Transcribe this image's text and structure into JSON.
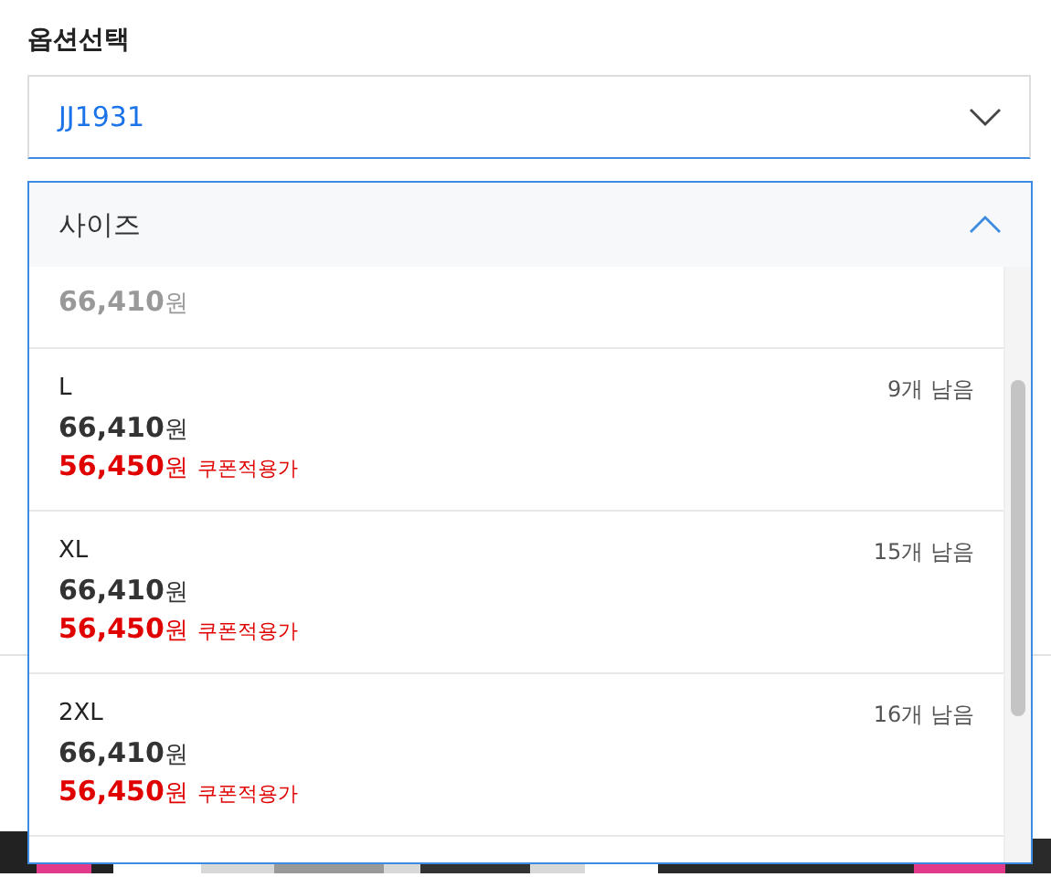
{
  "section_title": "옵션선택",
  "option_select": {
    "value": "JJ1931",
    "expanded": false
  },
  "size_dropdown": {
    "label": "사이즈",
    "expanded": true,
    "options": [
      {
        "kind": "partial",
        "sold_out": true,
        "price": "66,410",
        "unit": "원"
      },
      {
        "kind": "full",
        "sold_out": false,
        "name": "L",
        "stock": "9개 남음",
        "price": "66,410",
        "unit": "원",
        "sale_price": "56,450",
        "sale_unit": "원",
        "sale_note": "쿠폰적용가"
      },
      {
        "kind": "full",
        "sold_out": false,
        "name": "XL",
        "stock": "15개 남음",
        "price": "66,410",
        "unit": "원",
        "sale_price": "56,450",
        "sale_unit": "원",
        "sale_note": "쿠폰적용가"
      },
      {
        "kind": "full",
        "sold_out": false,
        "name": "2XL",
        "stock": "16개 남음",
        "price": "66,410",
        "unit": "원",
        "sale_price": "56,450",
        "sale_unit": "원",
        "sale_note": "쿠폰적용가"
      }
    ]
  }
}
